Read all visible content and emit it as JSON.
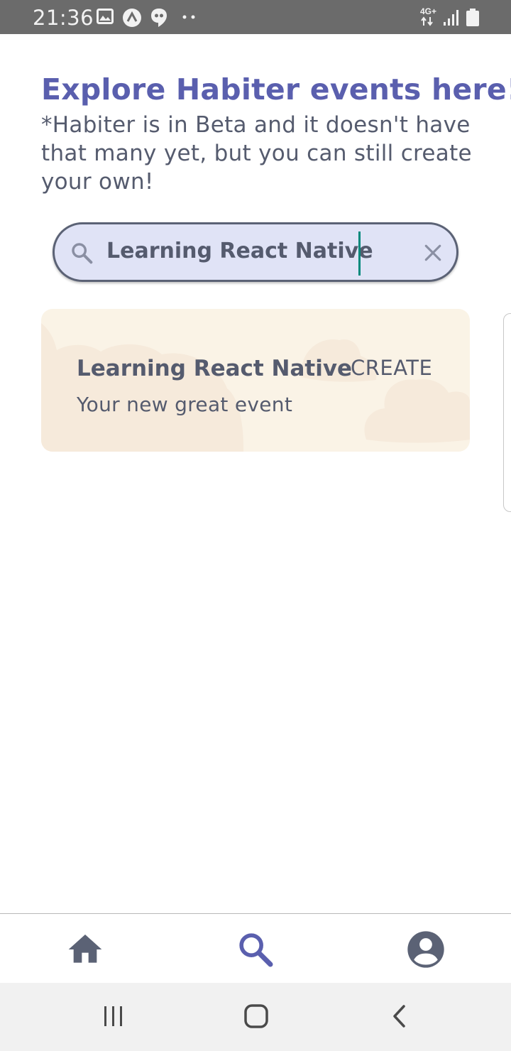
{
  "status_bar": {
    "time": "21:36",
    "network": "4G+",
    "left_icons": [
      "image-icon",
      "arrow-icon",
      "chat-icon",
      "more-dots-icon"
    ],
    "right_icons": [
      "network-4g-icon",
      "signal-icon",
      "battery-icon"
    ]
  },
  "header": {
    "title": "Explore Habiter events here!",
    "subtitle": "*Habiter is in Beta and it doesn't have that many yet, but you can still create your own!"
  },
  "search": {
    "value": "Learning React Native",
    "icon": "search-icon",
    "clear_icon": "close-icon"
  },
  "result_card": {
    "title": "Learning React Native",
    "action_label": "CREATE",
    "description": "Your new great event"
  },
  "tab_bar": {
    "items": [
      {
        "name": "home",
        "icon": "home-icon",
        "active": false
      },
      {
        "name": "search",
        "icon": "search-icon",
        "active": true
      },
      {
        "name": "profile",
        "icon": "account-circle-icon",
        "active": false
      }
    ]
  },
  "system_nav": [
    "recent-apps-icon",
    "home-button-icon",
    "back-icon"
  ],
  "colors": {
    "accent": "#5a5fae",
    "text": "#555b6e",
    "search_bg": "#e0e3f6",
    "card_bg": "#faf3e6",
    "caret": "#00897b"
  }
}
